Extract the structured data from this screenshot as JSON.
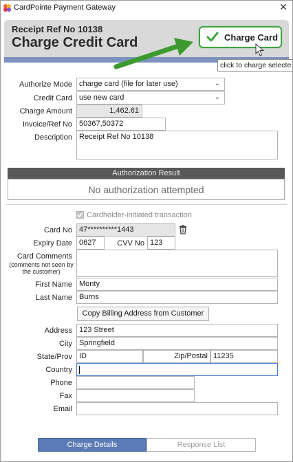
{
  "window": {
    "title": "CardPointe Payment Gateway",
    "close_label": "✕"
  },
  "header": {
    "receipt_ref": "Receipt Ref No 10138",
    "title": "Charge Credit Card",
    "charge_button_label": "Charge Card",
    "tooltip": "click to charge selecte"
  },
  "colors": {
    "header_bg": "#d9d9d9",
    "header_accent": "#7c93c0",
    "charge_border": "#3ba53b",
    "section_bar": "#595959",
    "active_tab": "#5b7bb6",
    "arrow": "#3c9a2e"
  },
  "form": {
    "authorize_mode_label": "Authorize Mode",
    "authorize_mode_value": "charge card (file for later use)",
    "credit_card_label": "Credit Card",
    "credit_card_value": "use new card",
    "charge_amount_label": "Charge Amount",
    "charge_amount_value": "1,462.61",
    "invoice_label": "Invoice/Ref No",
    "invoice_value": "50367,50372",
    "description_label": "Description",
    "description_value": "Receipt Ref No 10138"
  },
  "authorization": {
    "header": "Authorization Result",
    "result": "No authorization attempted"
  },
  "card": {
    "cardholder_initiated_label": "Cardholder-initiated transaction",
    "card_no_label": "Card No",
    "card_no_value": "47**********1443",
    "expiry_label": "Expiry Date",
    "expiry_value": "0627",
    "cvv_label": "CVV No",
    "cvv_value": "123",
    "comments_label": "Card Comments",
    "comments_note": "(comments not seen by the customer)",
    "comments_value": "",
    "first_name_label": "First Name",
    "first_name_value": "Monty",
    "last_name_label": "Last Name",
    "last_name_value": "Burns",
    "copy_billing_label": "Copy Billing Address from Customer"
  },
  "address": {
    "address_label": "Address",
    "address_value": "123 Street",
    "city_label": "City",
    "city_value": "Springfield",
    "state_label": "State/Prov",
    "state_value": "ID",
    "zip_label": "Zip/Postal",
    "zip_value": "11235",
    "country_label": "Country",
    "country_value": "",
    "phone_label": "Phone",
    "phone_value": "",
    "fax_label": "Fax",
    "fax_value": "",
    "email_label": "Email",
    "email_value": ""
  },
  "tabs": {
    "charge_details": "Charge Details",
    "response_list": "Response List"
  }
}
